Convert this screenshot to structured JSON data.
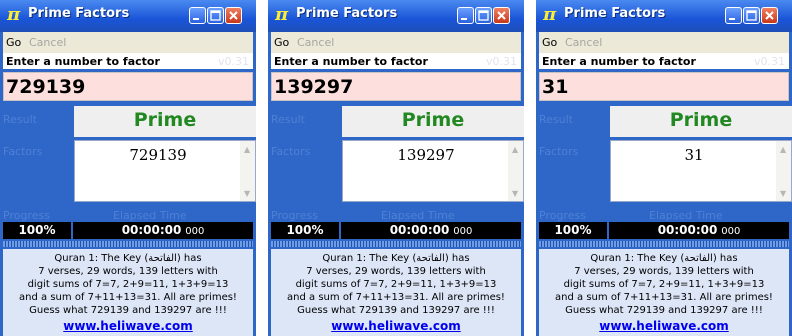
{
  "app": {
    "title": "Prime Factors",
    "pi_symbol": "π",
    "menu_go": "Go",
    "menu_cancel": "Cancel",
    "prompt": "Enter a number to factor",
    "version": "v0.31",
    "result_label": "Result",
    "factors_label": "Factors",
    "progress_label": "Progress",
    "elapsed_label": "Elapsed Time",
    "info_lines": [
      "Quran 1: The Key (الفاتحة) has",
      "7 verses, 29 words, 139 letters with",
      "digit sums of 7=7, 2+9=11, 1+3+9=13",
      "and a sum of 7+11+13=31. All are primes!",
      "Guess what 729139 and 139297 are !!!"
    ],
    "link": "www.heliwave.com"
  },
  "windows": [
    {
      "number": "729139",
      "result": "Prime",
      "factors": "729139",
      "progress": "100%",
      "elapsed": "00:00:00",
      "elapsed_ms": "000"
    },
    {
      "number": "139297",
      "result": "Prime",
      "factors": "139297",
      "progress": "100%",
      "elapsed": "00:00:00",
      "elapsed_ms": "000"
    },
    {
      "number": "31",
      "result": "Prime",
      "factors": "31",
      "progress": "100%",
      "elapsed": "00:00:00",
      "elapsed_ms": "000"
    }
  ],
  "colors": {
    "title_bar": "#1a55d8",
    "window_body": "#2e67c7",
    "input_background": "#fde0de",
    "result_text": "#228822",
    "link": "#0000ee"
  },
  "icons": [
    "pi-icon",
    "minimize-icon",
    "maximize-icon",
    "close-icon",
    "scroll-up-icon",
    "scroll-down-icon"
  ]
}
